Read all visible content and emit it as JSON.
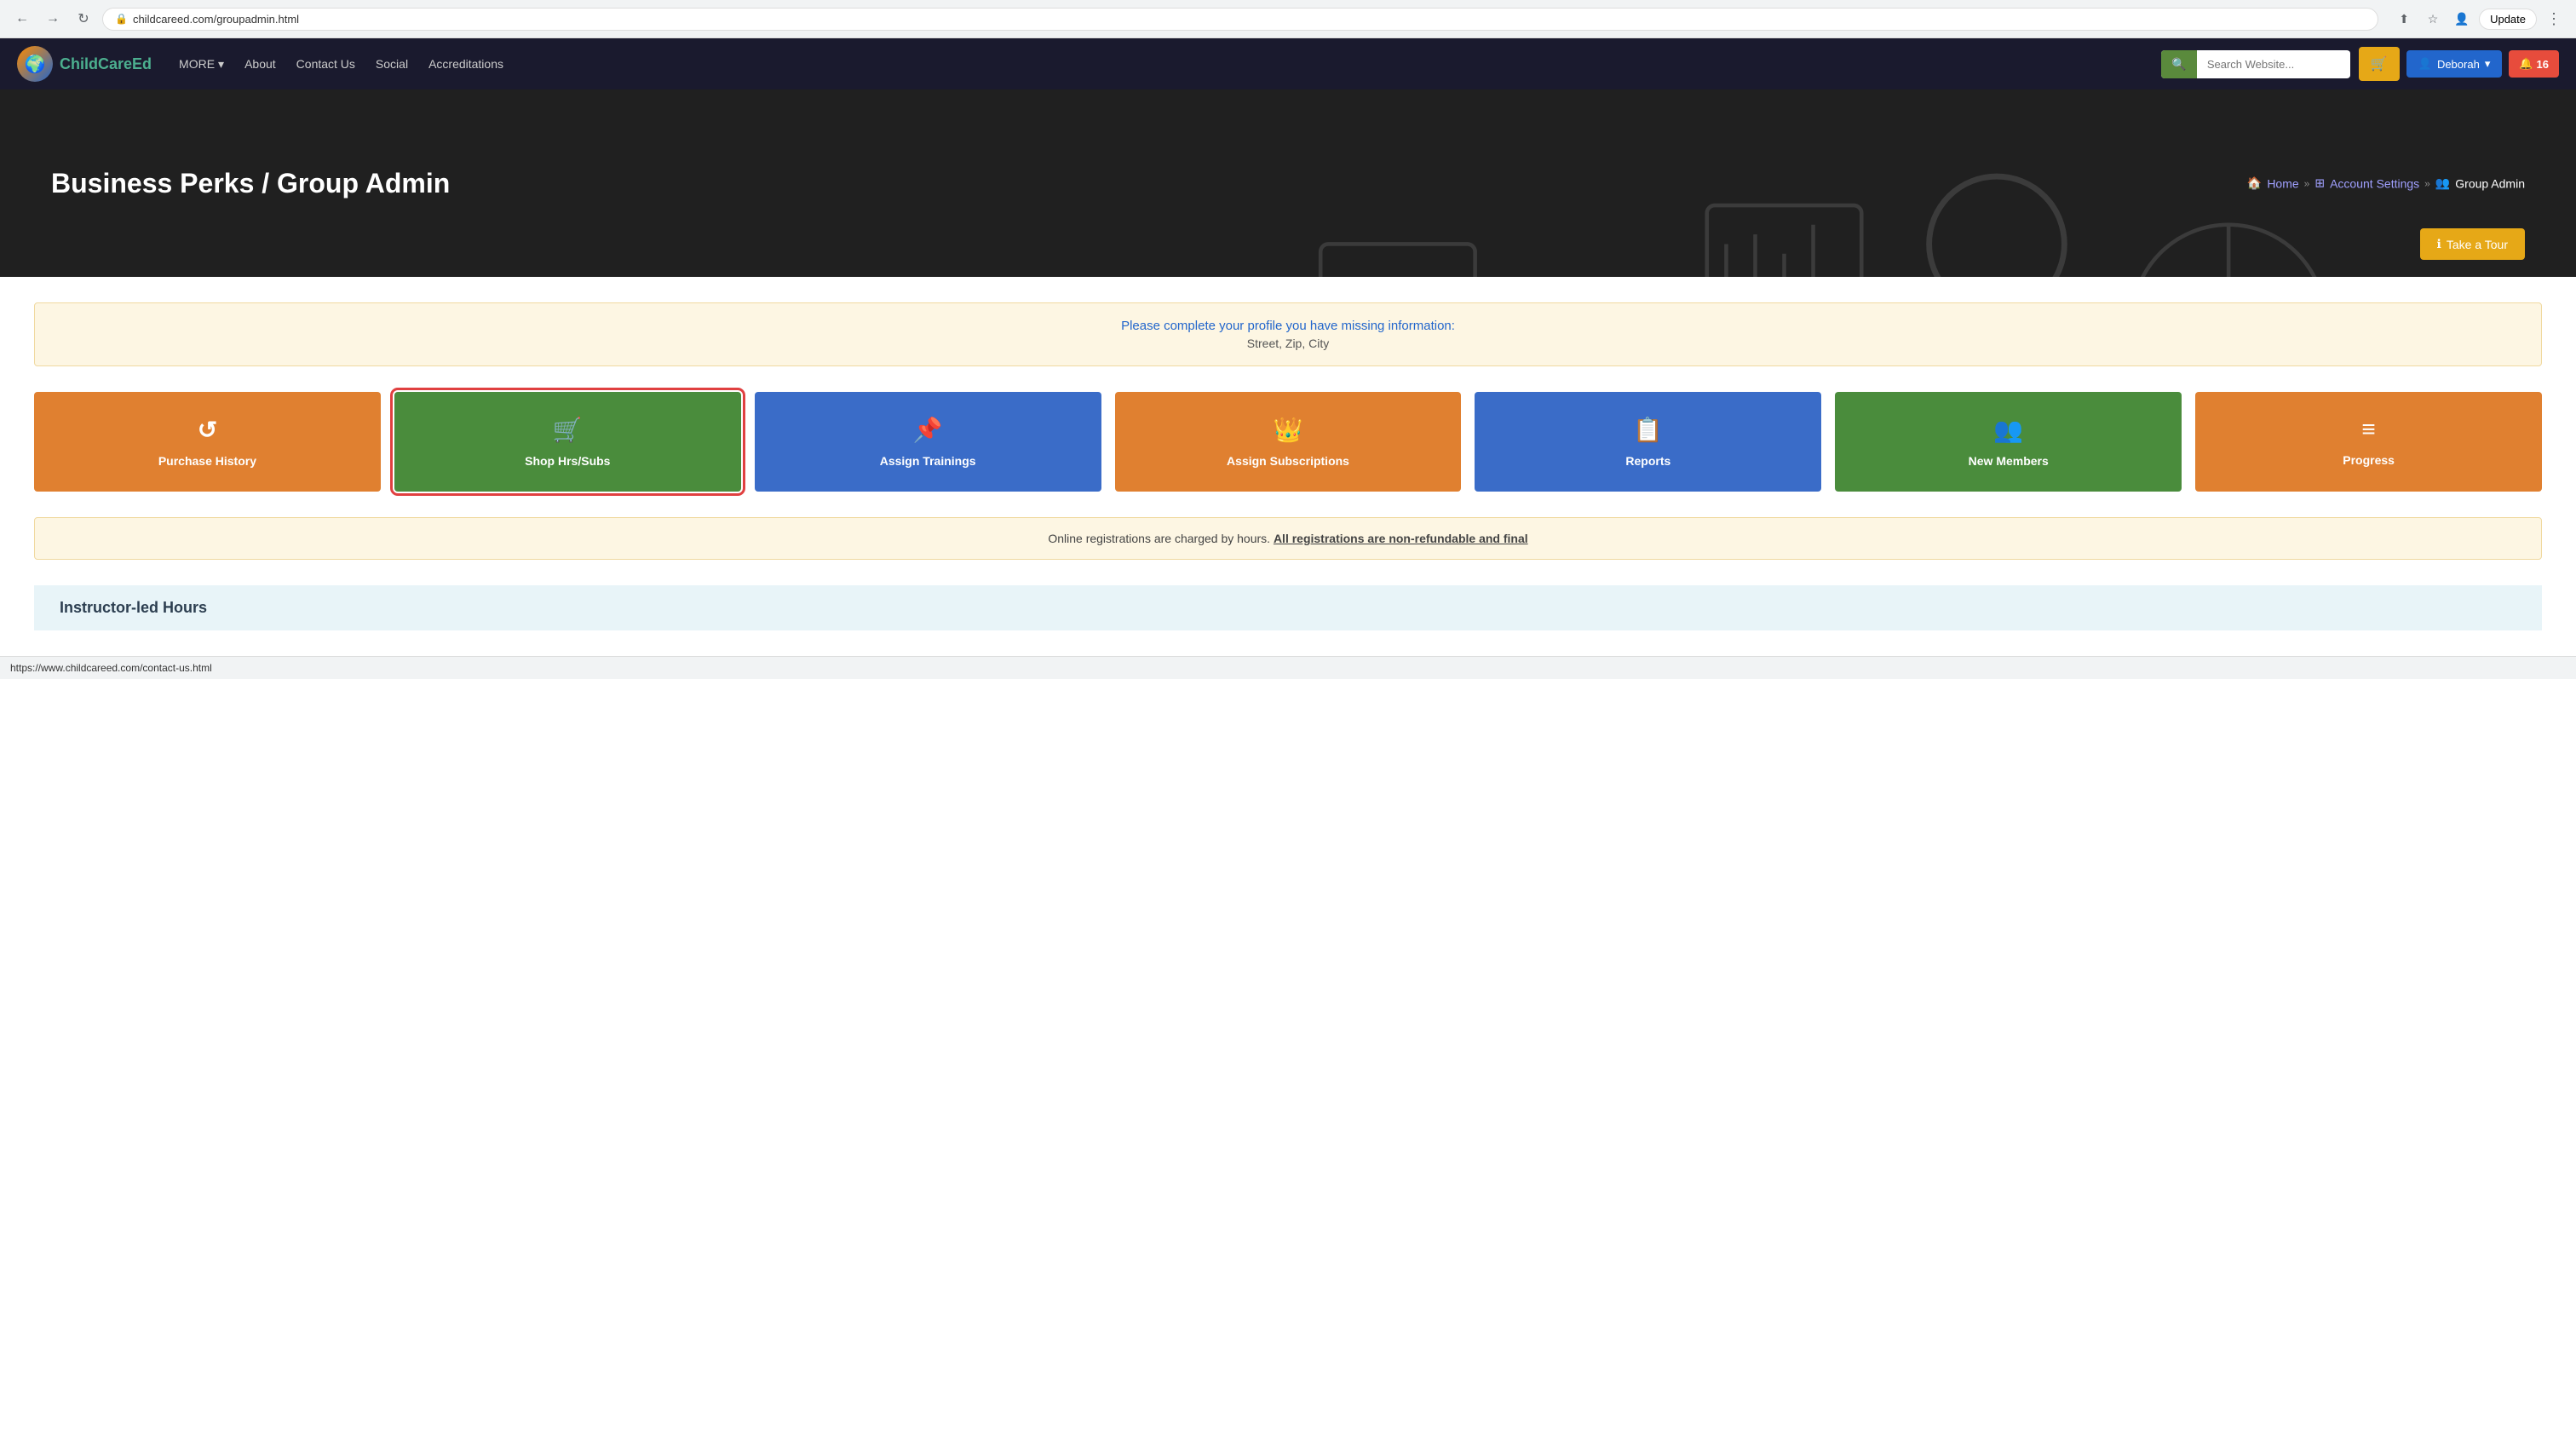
{
  "browser": {
    "url": "childcareed.com/groupadmin.html",
    "update_label": "Update",
    "menu_label": "⋮"
  },
  "navbar": {
    "logo_text_part1": "ChildCare",
    "logo_text_part2": "Ed",
    "nav_more": "MORE",
    "nav_about": "About",
    "nav_contact": "Contact Us",
    "nav_social": "Social",
    "nav_accreditations": "Accreditations",
    "search_placeholder": "Search Website...",
    "cart_icon": "🛒",
    "user_name": "Deborah",
    "notif_icon": "🔔",
    "notif_count": "16"
  },
  "hero": {
    "title": "Business Perks / Group Admin",
    "breadcrumb_home": "Home",
    "breadcrumb_account_settings": "Account Settings",
    "breadcrumb_current": "Group Admin",
    "take_tour_label": "Take a Tour"
  },
  "alert": {
    "link_text": "Please complete your profile you have missing information:",
    "sub_text": "Street, Zip, City"
  },
  "grid_buttons": [
    {
      "id": "purchase-history",
      "label": "Purchase History",
      "icon": "↺",
      "color": "btn-orange",
      "selected": false
    },
    {
      "id": "shop-hrs-subs",
      "label": "Shop Hrs/Subs",
      "icon": "🛒",
      "color": "btn-green",
      "selected": true
    },
    {
      "id": "assign-trainings",
      "label": "Assign Trainings",
      "icon": "📌",
      "color": "btn-blue",
      "selected": false
    },
    {
      "id": "assign-subscriptions",
      "label": "Assign Subscriptions",
      "icon": "👑",
      "color": "btn-gold-outline",
      "selected": false
    },
    {
      "id": "reports",
      "label": "Reports",
      "icon": "📋",
      "color": "btn-blue-dark",
      "selected": false
    },
    {
      "id": "new-members",
      "label": "New Members",
      "icon": "👥",
      "color": "btn-green-dark",
      "selected": false
    },
    {
      "id": "progress",
      "label": "Progress",
      "icon": "≡",
      "color": "btn-orange2",
      "selected": false
    }
  ],
  "notice": {
    "text_normal": "Online registrations are charged by hours.",
    "text_bold": "All registrations are non-refundable and final"
  },
  "instructor_section": {
    "title": "Instructor-led Hours"
  },
  "status_bar": {
    "url": "https://www.childcareed.com/contact-us.html"
  }
}
